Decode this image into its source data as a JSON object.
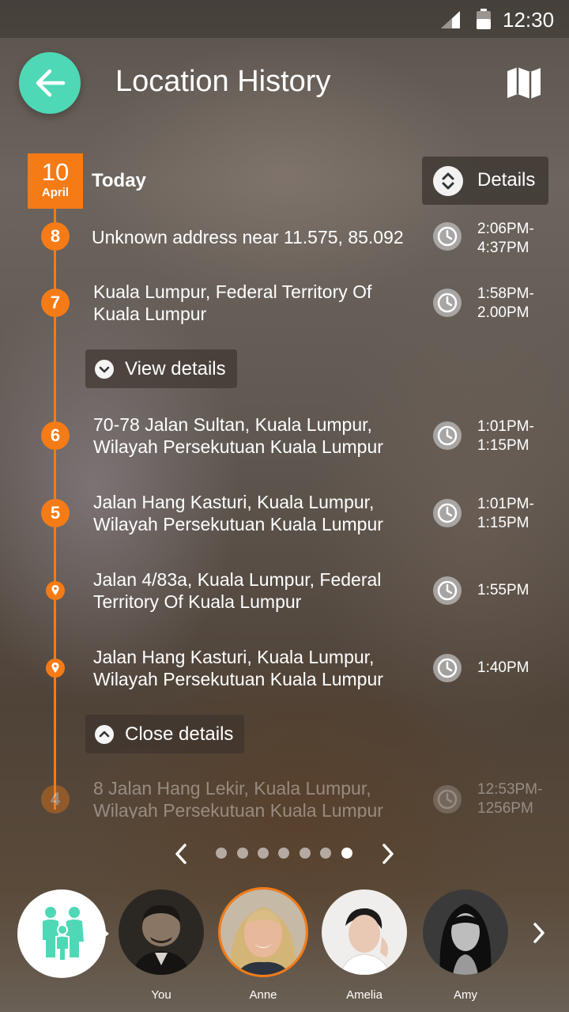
{
  "status_bar": {
    "time": "12:30"
  },
  "header": {
    "title": "Location History"
  },
  "date": {
    "day": "10",
    "month": "April",
    "label": "Today"
  },
  "details_button": {
    "label": "Details"
  },
  "entries": [
    {
      "marker": "8",
      "address": "Unknown address near 11.575, 85.092",
      "time": "2:06PM-\n4:37PM"
    },
    {
      "marker": "7",
      "address": "Kuala Lumpur, Federal Territory Of Kuala Lumpur",
      "time": "1:58PM-\n2.00PM"
    },
    {
      "marker": "6",
      "address": "70-78 Jalan Sultan, Kuala Lumpur, Wilayah Persekutuan Kuala Lumpur",
      "time": "1:01PM-\n1:15PM"
    },
    {
      "marker": "5",
      "address": "Jalan Hang Kasturi, Kuala Lumpur, Wilayah Persekutuan Kuala Lumpur",
      "time": "1:01PM-\n1:15PM"
    },
    {
      "marker": "",
      "address": "Jalan 4/83a, Kuala Lumpur, Federal Territory Of Kuala Lumpur",
      "time": "1:55PM"
    },
    {
      "marker": "",
      "address": "Jalan Hang Kasturi, Kuala Lumpur, Wilayah Persekutuan Kuala Lumpur",
      "time": "1:40PM"
    },
    {
      "marker": "4",
      "address": "8 Jalan Hang Lekir, Kuala Lumpur, Wilayah Persekutuan Kuala Lumpur",
      "time": "12:53PM-\n1256PM"
    }
  ],
  "view_details": {
    "label": "View details"
  },
  "close_details": {
    "label": "Close details"
  },
  "pager": {
    "count": 7,
    "active_index": 6
  },
  "contacts": [
    {
      "name": "You",
      "selected": false
    },
    {
      "name": "Anne",
      "selected": true
    },
    {
      "name": "Amelia",
      "selected": false
    },
    {
      "name": "Amy",
      "selected": false
    }
  ],
  "colors": {
    "accent": "#f57b16",
    "back_button": "#4fd8b6"
  }
}
